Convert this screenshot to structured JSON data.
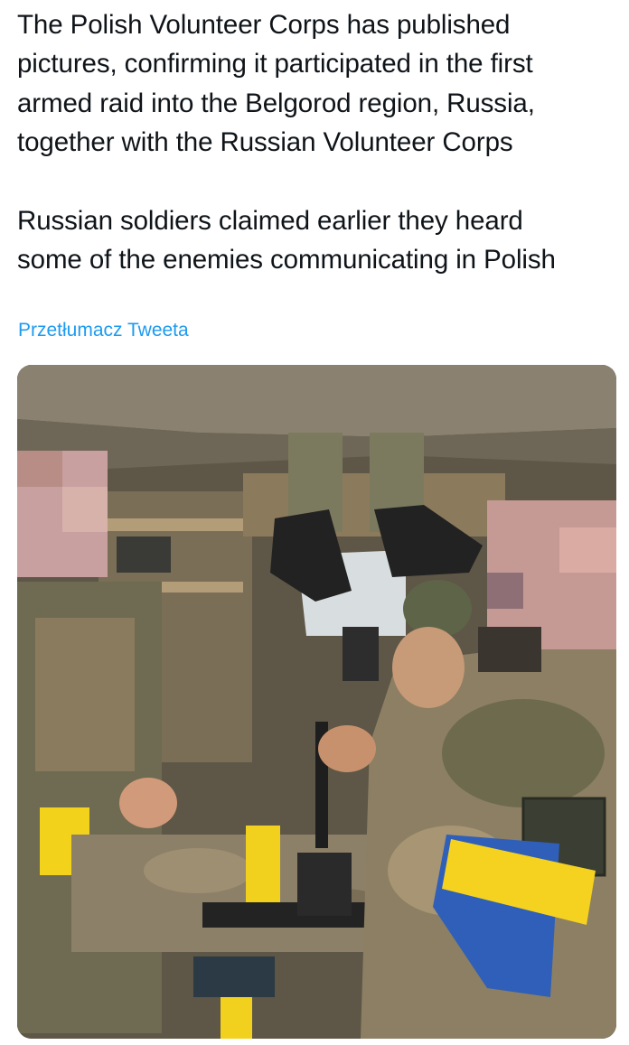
{
  "tweet": {
    "paragraphs": [
      [
        "The Polish Volunteer Corps has published",
        "pictures, confirming it participated in the first",
        "armed raid into the Belgorod region, Russia,",
        "together with the Russian Volunteer Corps"
      ],
      [
        "Russian soldiers claimed earlier they heard",
        "some of the enemies communicating in Polish"
      ]
    ],
    "translate_label": "Przetłumacz Tweeta",
    "link_color": "#1d9bf0"
  },
  "media": {
    "kind": "photo",
    "colors": {
      "interior": "#6b604a",
      "armband": "#f5d21f",
      "flag": "#2f5fb8"
    }
  }
}
